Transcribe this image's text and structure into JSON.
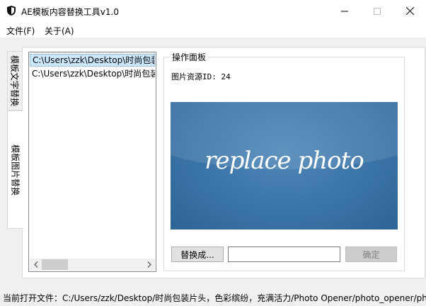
{
  "window": {
    "title": "AE模板内容替换工具v1.0",
    "controls": {
      "minimize": "—",
      "maximize": "☐",
      "close": "✕"
    }
  },
  "menu": {
    "file": "文件(F)",
    "about": "关于(A)"
  },
  "tabs": [
    {
      "label": "模板文字替换",
      "active": false
    },
    {
      "label": "模板图片替换",
      "active": true
    }
  ],
  "file_list": {
    "items": [
      {
        "path": "C:\\Users\\zzk\\Desktop\\时尚包装",
        "selected": true
      },
      {
        "path": "C:\\Users\\zzk\\Desktop\\时尚包装",
        "selected": false
      }
    ],
    "scroll_left": "<",
    "scroll_right": ">"
  },
  "panel": {
    "title": "操作面板",
    "resource_id": "图片资源ID: 24",
    "preview_text": "replace photo",
    "replace_button": "替换成...",
    "path_value": "",
    "ok_button": "确定"
  },
  "status": {
    "text": "当前打开文件：C:/Users/zzk/Desktop/时尚包装片头，色彩缤纷，充满活力/Photo Opener/photo_opener/ph"
  },
  "colors": {
    "preview_bg": "#3a74a7",
    "selection": "#cce8ff"
  }
}
